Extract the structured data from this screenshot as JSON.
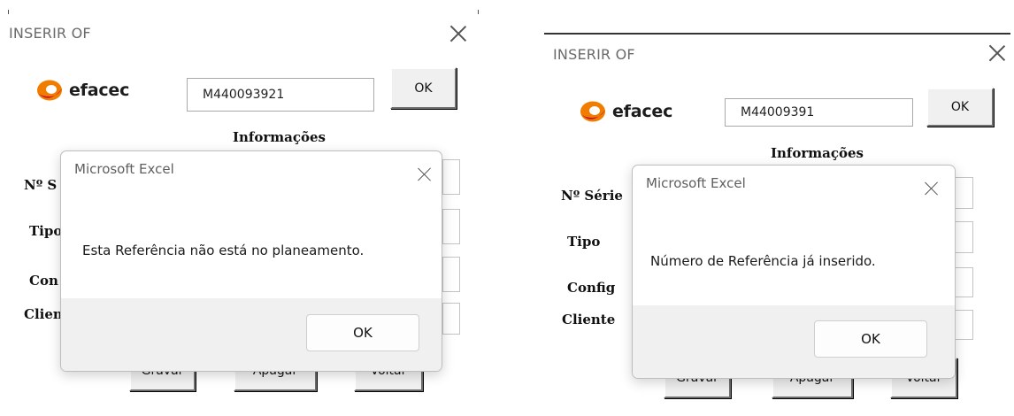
{
  "colors": {
    "logo_orange": "#f07d00",
    "logo_red": "#c8102e"
  },
  "left": {
    "form": {
      "title": "INSERIR OF",
      "close_icon": "close-icon",
      "logo_text": "efacec",
      "reference_value": "M440093921",
      "ok_label": "OK",
      "section_title": "Informações",
      "labels": {
        "serie": "Nº S",
        "tipo": "Tipo",
        "config": "Con",
        "cliente": "Clien"
      },
      "buttons": {
        "gravar": "Gravar",
        "apagar": "Apagar",
        "voltar": "Voltar"
      }
    },
    "dialog": {
      "title": "Microsoft Excel",
      "message": "Esta Referência não está no planeamento.",
      "ok_label": "OK"
    }
  },
  "right": {
    "form": {
      "title": "INSERIR OF",
      "close_icon": "close-icon",
      "logo_text": "efacec",
      "reference_value": "M44009391",
      "ok_label": "OK",
      "section_title": "Informações",
      "labels": {
        "serie": "Nº Série",
        "tipo": "Tipo",
        "config": "Config",
        "cliente": "Cliente"
      },
      "buttons": {
        "gravar": "Gravar",
        "apagar": "Apagar",
        "voltar": "Voltar"
      }
    },
    "dialog": {
      "title": "Microsoft Excel",
      "message": "Número de Referência já inserido.",
      "ok_label": "OK"
    }
  }
}
